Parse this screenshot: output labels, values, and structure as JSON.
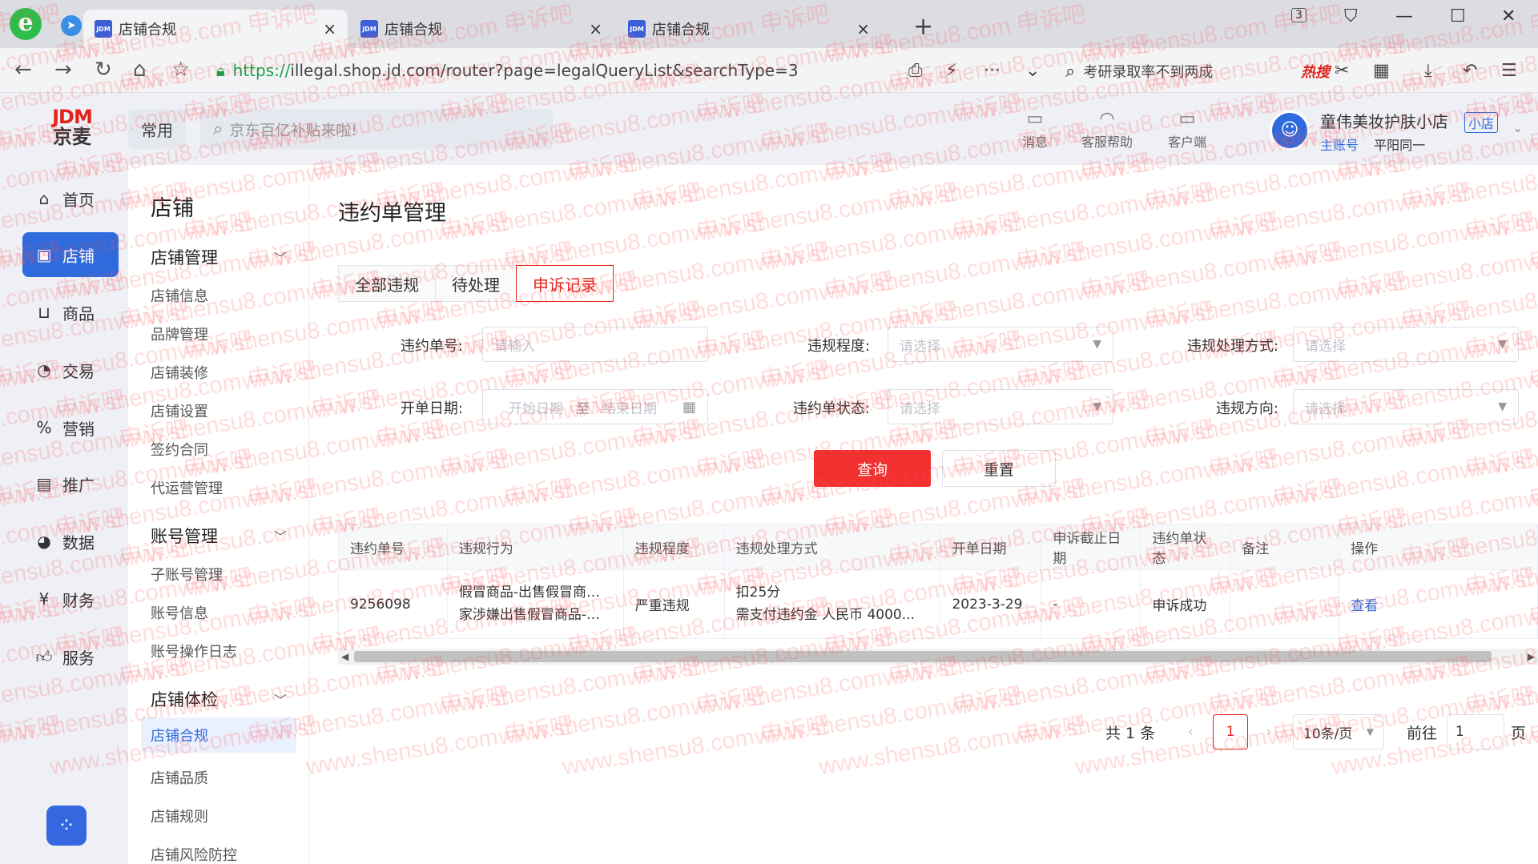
{
  "browser": {
    "tabs": [
      {
        "favicon": "JDM",
        "title": "店铺合规",
        "active": true
      },
      {
        "favicon": "JDM",
        "title": "店铺合规",
        "active": false
      },
      {
        "favicon": "JDM",
        "title": "店铺合规",
        "active": false
      }
    ],
    "tab_count": "3",
    "url_scheme": "https://",
    "url_rest": "illegal.shop.jd.com/router?page=legalQueryList&searchType=3",
    "search_text": "考研录取率不到两成",
    "search_hot": "热搜"
  },
  "header": {
    "logo_line1": "JDM",
    "logo_line2": "京麦",
    "common": "常用",
    "search_placeholder": "京东百亿补贴来啦!",
    "tools": [
      {
        "icon": "message-icon",
        "label": "消息"
      },
      {
        "icon": "headset-icon",
        "label": "客服帮助"
      },
      {
        "icon": "monitor-icon",
        "label": "客户端"
      }
    ],
    "shop_name": "童伟美妆护肤小店",
    "shop_tag": "小店",
    "account_type": "主账号",
    "account_name": "平阳同一"
  },
  "leftnav": [
    {
      "icon": "home-icon",
      "label": "首页",
      "active": false
    },
    {
      "icon": "shop-icon",
      "label": "店铺",
      "active": true
    },
    {
      "icon": "basket-icon",
      "label": "商品",
      "active": false
    },
    {
      "icon": "trade-icon",
      "label": "交易",
      "active": false
    },
    {
      "icon": "marketing-icon",
      "label": "营销",
      "active": false
    },
    {
      "icon": "promote-icon",
      "label": "推广",
      "active": false
    },
    {
      "icon": "data-icon",
      "label": "数据",
      "active": false
    },
    {
      "icon": "finance-icon",
      "label": "财务",
      "active": false
    },
    {
      "icon": "service-icon",
      "label": "服务",
      "active": false
    }
  ],
  "subnav": {
    "title": "店铺",
    "groups": [
      {
        "label": "店铺管理",
        "items": [
          "店铺信息",
          "品牌管理",
          "店铺装修",
          "店铺设置",
          "签约合同",
          "代运营管理"
        ]
      },
      {
        "label": "账号管理",
        "items": [
          "子账号管理",
          "账号信息",
          "账号操作日志"
        ]
      },
      {
        "label": "店铺体检",
        "items": [
          "店铺合规",
          "店铺品质",
          "店铺规则",
          "店铺风险防控"
        ]
      }
    ],
    "active_item": "店铺合规"
  },
  "main": {
    "title": "违约单管理",
    "tabs": [
      "全部违规",
      "待处理",
      "申诉记录"
    ],
    "selected_tab": "申诉记录",
    "filters": {
      "order_no_label": "违约单号:",
      "order_no_placeholder": "请输入",
      "severity_label": "违规程度:",
      "severity_placeholder": "请选择",
      "handling_label": "违规处理方式:",
      "handling_placeholder": "请选择",
      "date_label": "开单日期:",
      "date_start": "开始日期",
      "date_sep": "至",
      "date_end": "结束日期",
      "status_label": "违约单状态:",
      "status_placeholder": "请选择",
      "direction_label": "违规方向:",
      "direction_placeholder": "请选择"
    },
    "query_btn": "查询",
    "reset_btn": "重置",
    "table": {
      "columns": [
        "违约单号",
        "违规行为",
        "违规程度",
        "违规处理方式",
        "开单日期",
        "申诉截止日期",
        "违约单状态",
        "备注",
        "操作"
      ],
      "rows": [
        {
          "order_no": "9256098",
          "behavior_line1": "假冒商品-出售假冒商品（商",
          "behavior_line2": "家涉嫌出售假冒商品-其他-...",
          "severity": "严重违规",
          "handling_line1": "扣25分",
          "handling_line2": "需支付违约金 人民币 4000...",
          "open_date": "2023-3-29",
          "appeal_deadline": "-",
          "status": "申诉成功",
          "note": "",
          "action": "查看"
        }
      ]
    },
    "pager": {
      "total": "共 1 条",
      "current_page": "1",
      "page_size": "10条/页",
      "goto_label": "前往",
      "goto_value": "1",
      "page_suffix": "页"
    }
  },
  "watermark": "www.shensu8.com 申诉吧",
  "colors": {
    "brand_red": "#e2231a",
    "primary_blue": "#2f6bdc",
    "success_green": "#19be6b",
    "query_red": "#f23030"
  }
}
